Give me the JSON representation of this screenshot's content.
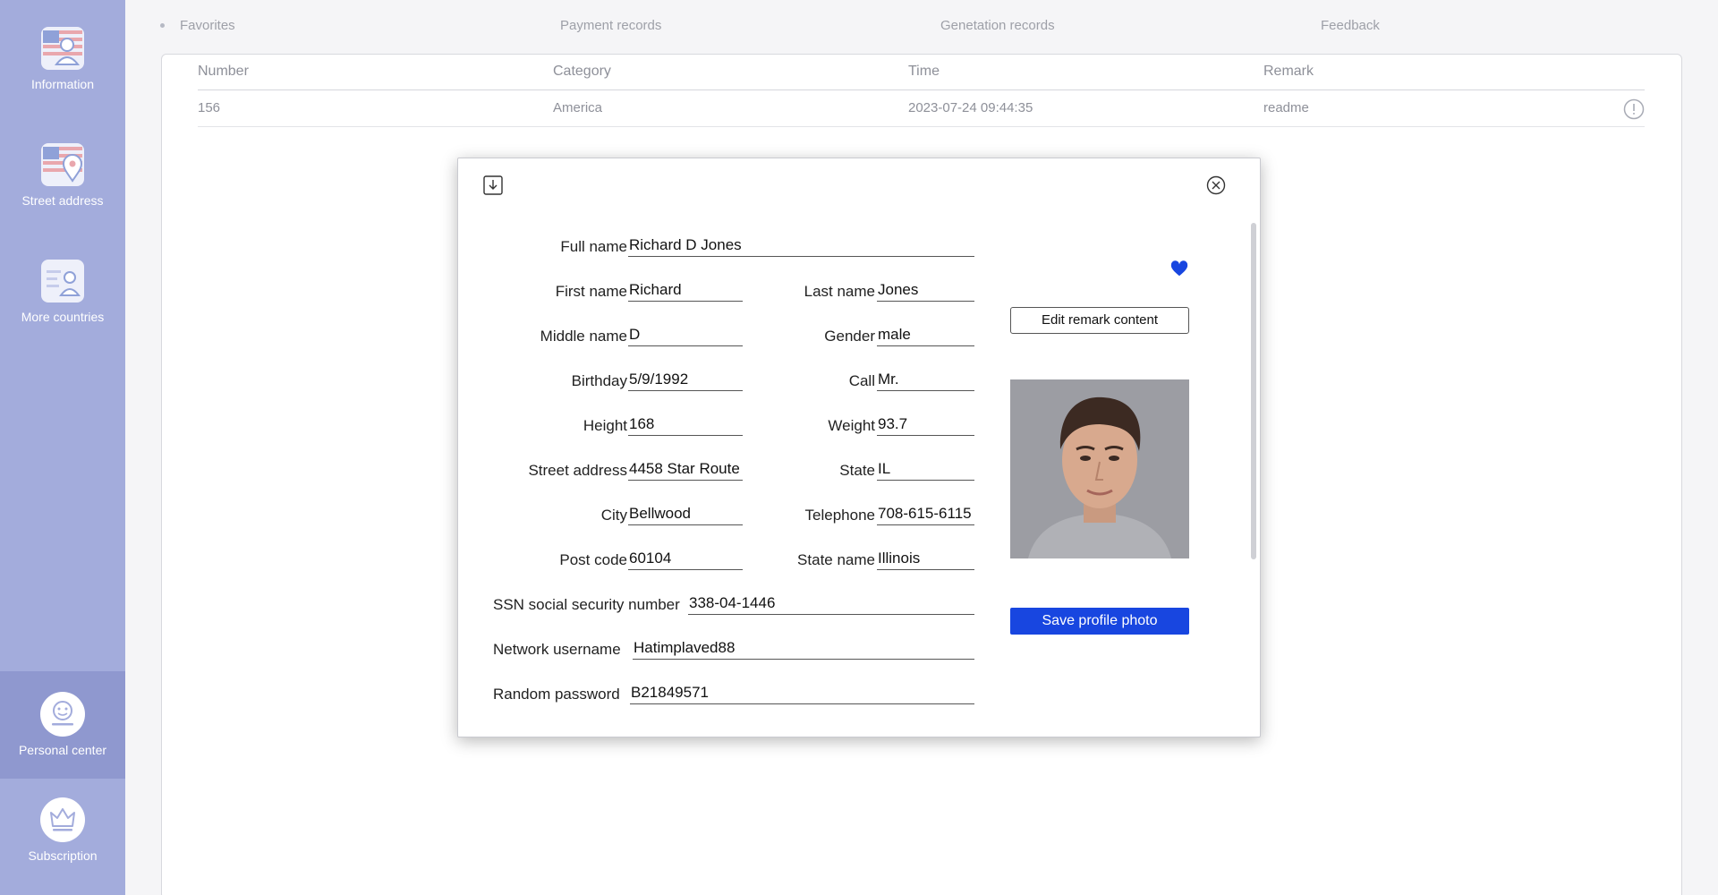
{
  "sidebar": {
    "items": [
      {
        "label": "Information",
        "icon": "flag-user-icon"
      },
      {
        "label": "Street address",
        "icon": "flag-location-icon"
      },
      {
        "label": "More countries",
        "icon": "id-card-icon"
      },
      {
        "label": "Personal center",
        "icon": "smiley-face-icon"
      },
      {
        "label": "Subscription",
        "icon": "crown-icon"
      }
    ],
    "active": "Personal center"
  },
  "tabs": [
    "Favorites",
    "Payment records",
    "Genetation records",
    "Feedback"
  ],
  "table": {
    "headers": [
      "Number",
      "Category",
      "Time",
      "Remark"
    ],
    "rows": [
      {
        "number": "156",
        "category": "America",
        "time": "2023-07-24 09:44:35",
        "remark": "readme"
      }
    ]
  },
  "dialog": {
    "fields": {
      "full_name": {
        "label": "Full name",
        "value": "Richard D Jones"
      },
      "first_name": {
        "label": "First name",
        "value": "Richard"
      },
      "last_name": {
        "label": "Last name",
        "value": "Jones"
      },
      "middle_name": {
        "label": "Middle name",
        "value": "D"
      },
      "gender": {
        "label": "Gender",
        "value": "male"
      },
      "birthday": {
        "label": "Birthday",
        "value": "5/9/1992"
      },
      "call": {
        "label": "Call",
        "value": "Mr."
      },
      "height": {
        "label": "Height",
        "value": "168"
      },
      "weight": {
        "label": "Weight",
        "value": "93.7"
      },
      "street": {
        "label": "Street address",
        "value": "4458  Star Route"
      },
      "state": {
        "label": "State",
        "value": "IL"
      },
      "city": {
        "label": "City",
        "value": "Bellwood"
      },
      "telephone": {
        "label": "Telephone",
        "value": "708-615-6115"
      },
      "post_code": {
        "label": "Post code",
        "value": "60104"
      },
      "state_name": {
        "label": "State name",
        "value": "Illinois"
      },
      "ssn": {
        "label": "SSN social security number",
        "value": "338-04-1446"
      },
      "username": {
        "label": "Network username",
        "value": "Hatimplaved88"
      },
      "password": {
        "label": "Random password",
        "value": "B21849571"
      }
    },
    "edit_remark_label": "Edit remark content",
    "save_photo_label": "Save profile photo"
  },
  "colors": {
    "sidebar": "#a3acdc",
    "accent_blue": "#1846e0"
  }
}
